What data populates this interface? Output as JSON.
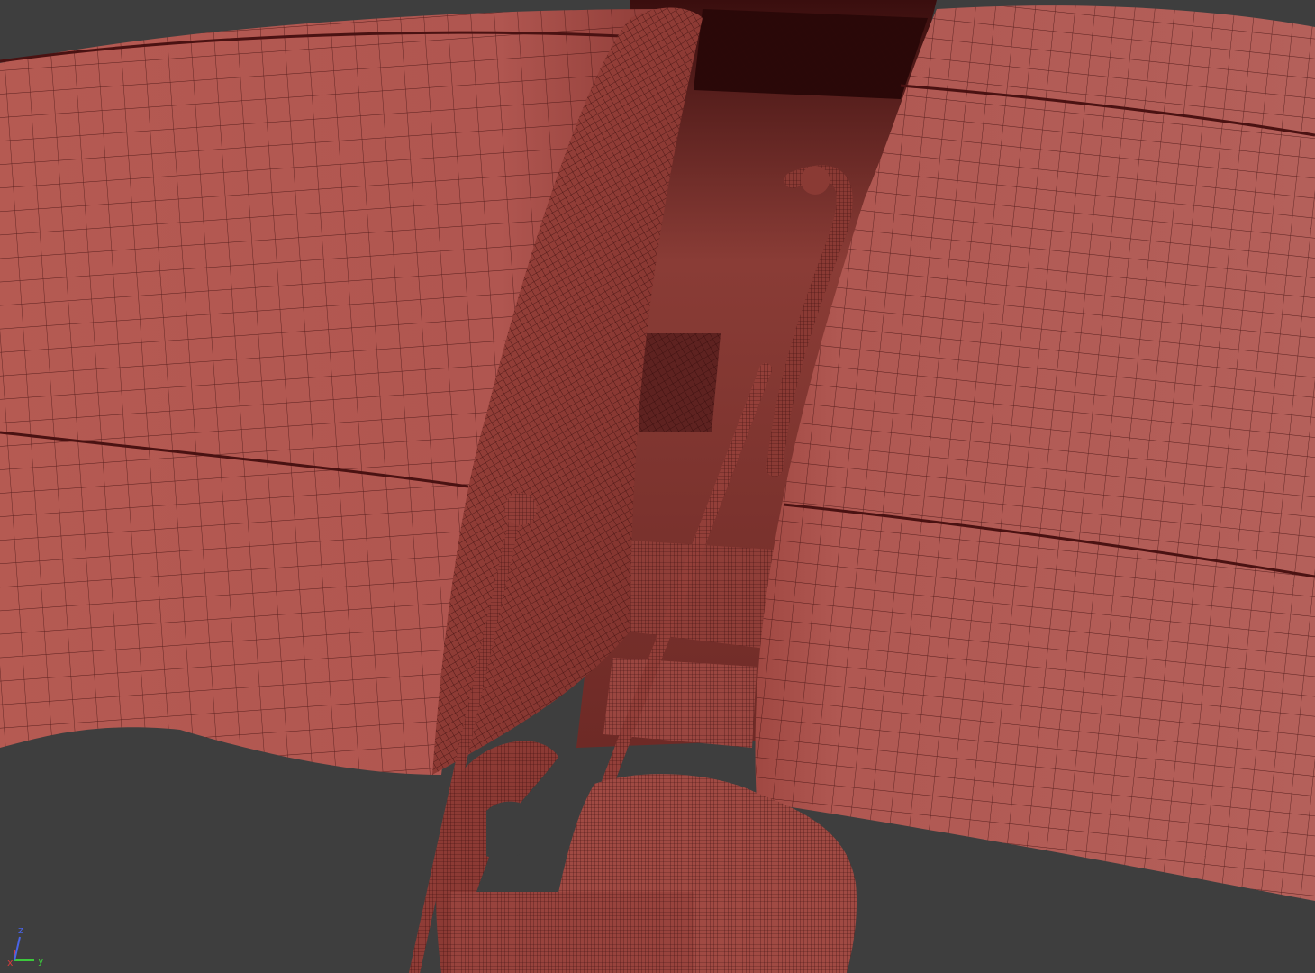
{
  "viewport": {
    "background": "#3e3e3e",
    "mesh_color": "#b2574f",
    "wire_color": "#3a0c0c",
    "interior_color": "#6e2a26"
  },
  "gizmo": {
    "x_label": "x",
    "y_label": "y",
    "z_label": "z",
    "x_color": "#d23c3c",
    "y_color": "#3cc83c",
    "z_color": "#4a64e6"
  }
}
